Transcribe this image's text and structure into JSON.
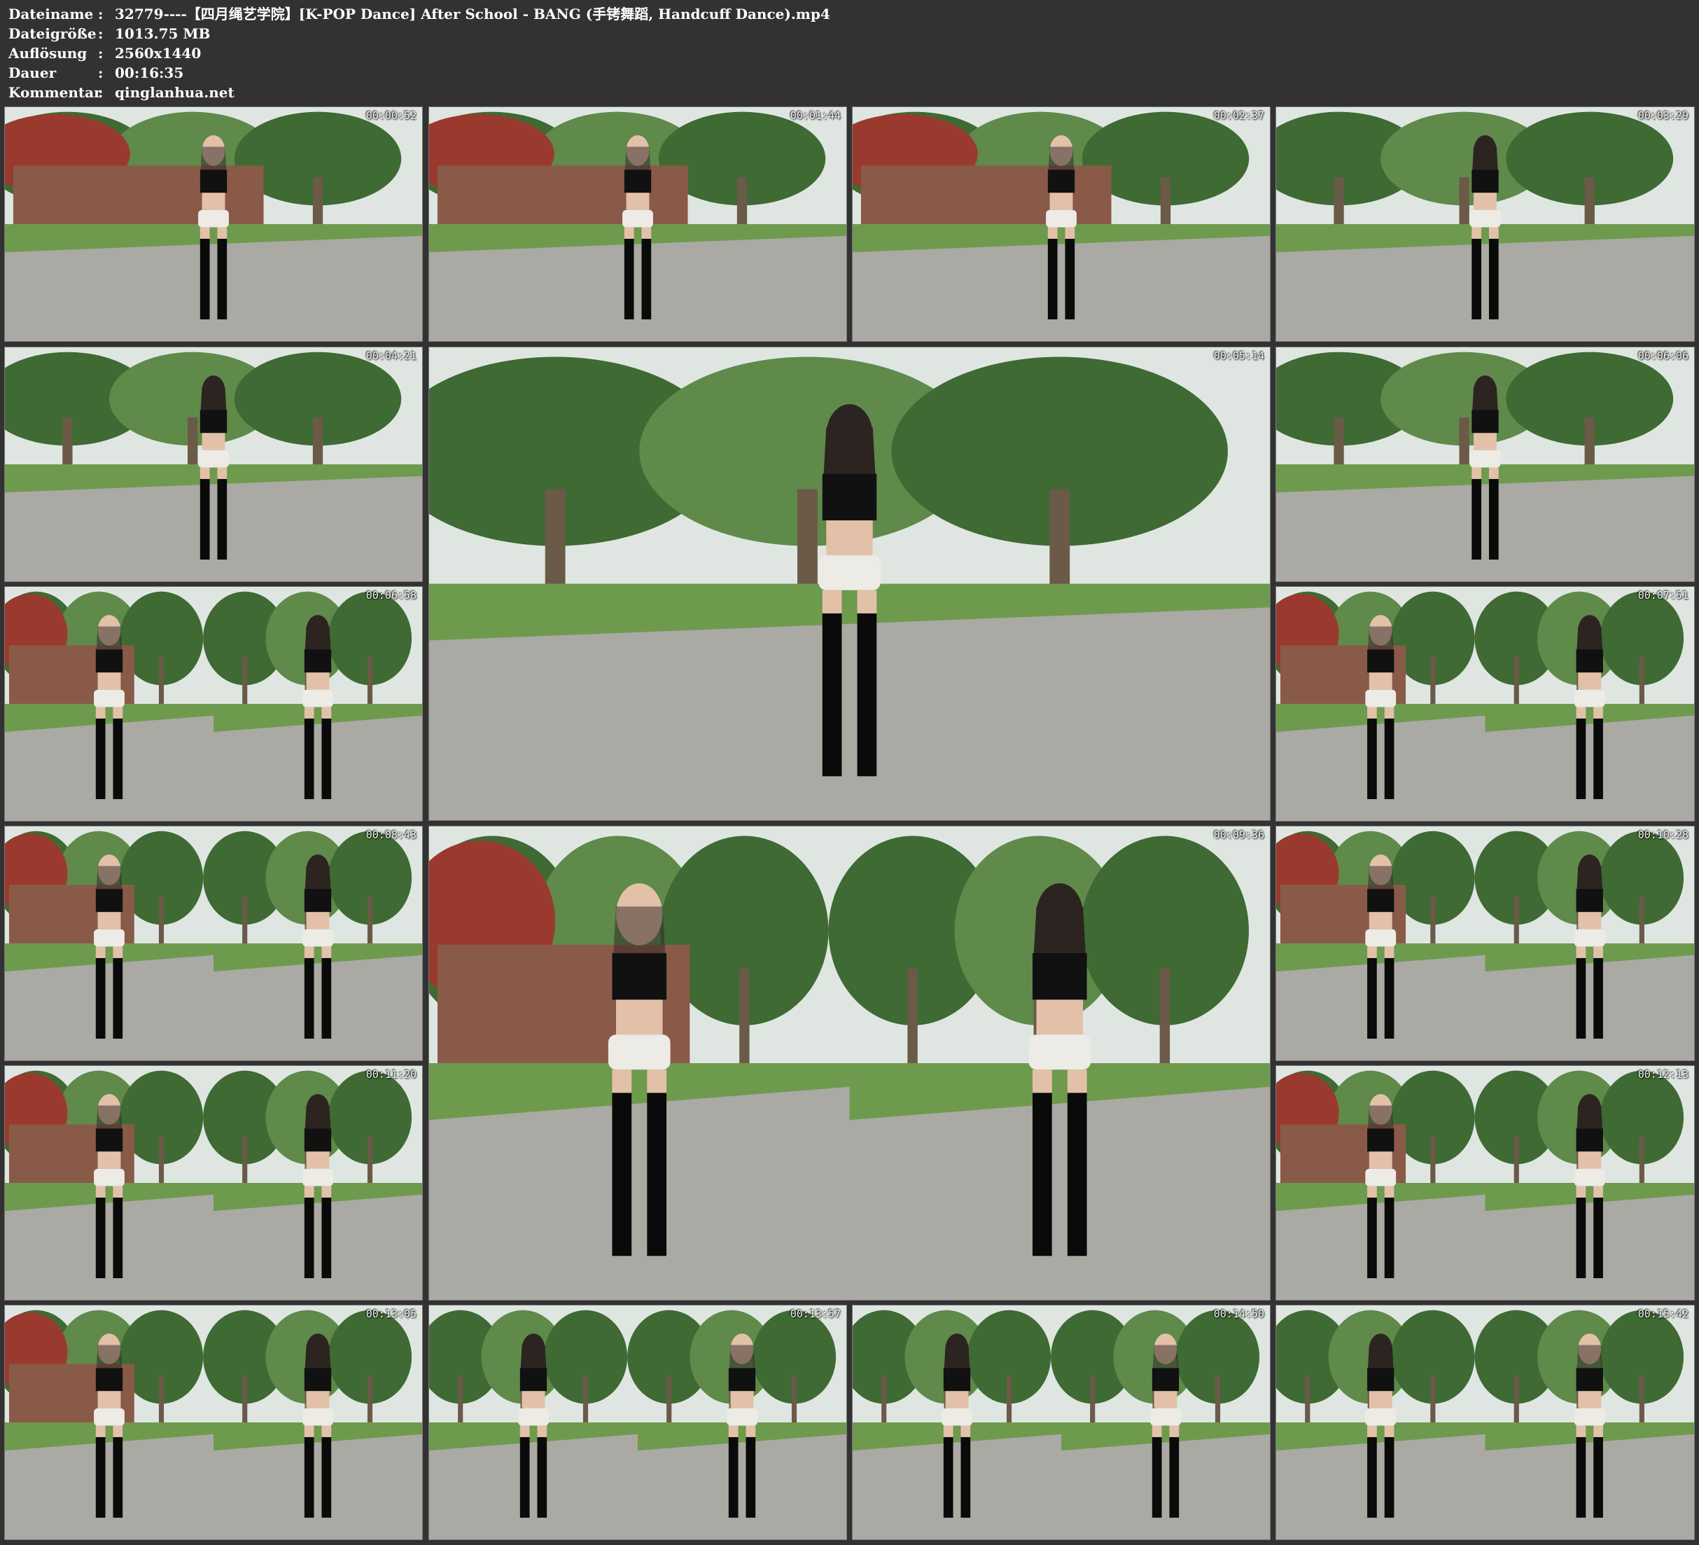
{
  "info": [
    {
      "key": "Dateiname",
      "sep": ":",
      "value": "32779----【四月绳艺学院】[K-POP Dance] After School - BANG (手铐舞蹈, Handcuff Dance).mp4"
    },
    {
      "key": "Dateigröße",
      "sep": ":",
      "value": "1013.75 MB"
    },
    {
      "key": "Auflösung",
      "sep": ":",
      "value": "2560x1440"
    },
    {
      "key": "Dauer",
      "sep": ":",
      "value": "00:16:35"
    },
    {
      "key": "Kommentar",
      "sep": ":",
      "value": "qinglanhua.net"
    }
  ],
  "colors": {
    "background": "#323232",
    "sky": "#dfe6e2",
    "tree": "#5f8a4a",
    "tree_dark": "#3f6a33",
    "maple": "#9a3a2e",
    "brick": "#8a5a48",
    "grass": "#6e9a4e",
    "path": "#aaa9a4",
    "top": "#111111",
    "shorts": "#ecebe6",
    "boots": "#0a0a0a",
    "skin": "#e3c1a9",
    "hair": "#2c2421"
  },
  "thumbnails": [
    {
      "id": "t1",
      "ts": "00:00:52",
      "kind": "wall",
      "pose": "front"
    },
    {
      "id": "t2",
      "ts": "00:01:44",
      "kind": "wall",
      "pose": "spin"
    },
    {
      "id": "t3",
      "ts": "00:02:37",
      "kind": "wall",
      "pose": "front"
    },
    {
      "id": "t4",
      "ts": "00:03:29",
      "kind": "park",
      "pose": "back"
    },
    {
      "id": "t5",
      "ts": "00:04:21",
      "kind": "park",
      "pose": "back"
    },
    {
      "id": "t6",
      "ts": "00:05:14",
      "kind": "park",
      "pose": "back"
    },
    {
      "id": "t7",
      "ts": "00:06:06",
      "kind": "park",
      "pose": "back"
    },
    {
      "id": "t8",
      "ts": "00:06:58",
      "kind": "split",
      "pose": "front"
    },
    {
      "id": "t9",
      "ts": "00:07:51",
      "kind": "split",
      "pose": "front"
    },
    {
      "id": "t10",
      "ts": "00:08:43",
      "kind": "split",
      "pose": "front"
    },
    {
      "id": "t11",
      "ts": "00:09:36",
      "kind": "split",
      "pose": "front"
    },
    {
      "id": "t12",
      "ts": "00:10:28",
      "kind": "split",
      "pose": "front"
    },
    {
      "id": "t13",
      "ts": "00:11:20",
      "kind": "split",
      "pose": "front"
    },
    {
      "id": "t14",
      "ts": "00:12:13",
      "kind": "split",
      "pose": "front"
    },
    {
      "id": "t15",
      "ts": "00:13:05",
      "kind": "split",
      "pose": "front"
    },
    {
      "id": "t16",
      "ts": "00:13:57",
      "kind": "split2",
      "pose": "back"
    },
    {
      "id": "t17",
      "ts": "00:14:50",
      "kind": "split2",
      "pose": "back"
    },
    {
      "id": "t18",
      "ts": "00:15:42",
      "kind": "split2",
      "pose": "back"
    }
  ]
}
